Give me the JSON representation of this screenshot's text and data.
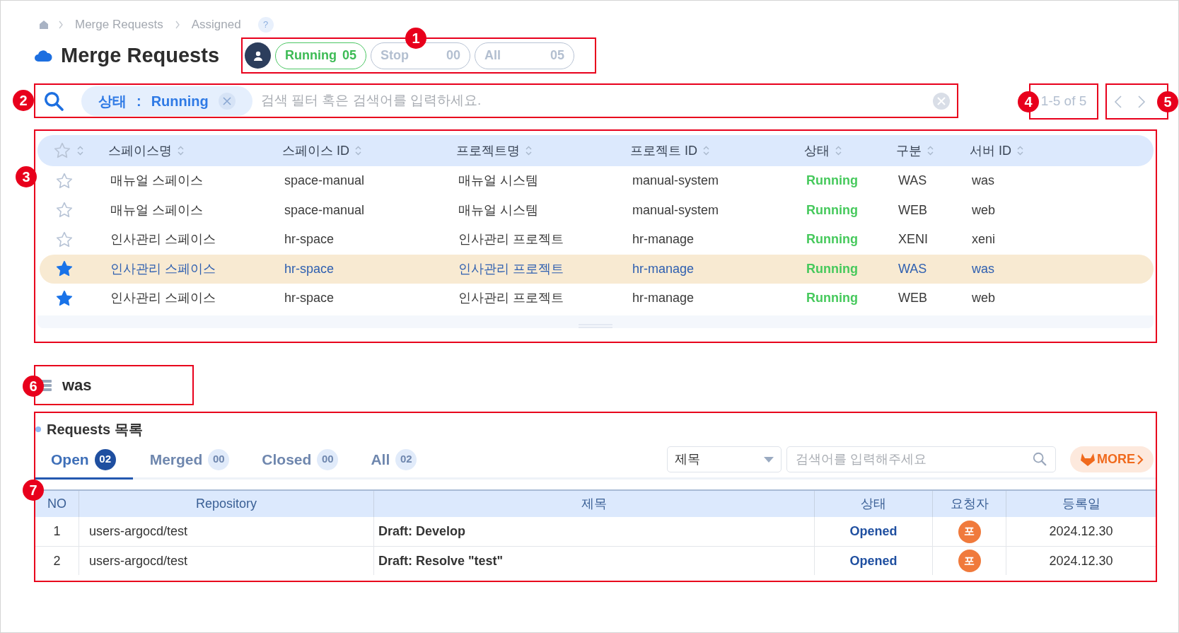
{
  "breadcrumb": [
    "Merge Requests",
    "Assigned"
  ],
  "help": "?",
  "title": "Merge Requests",
  "status_filters": [
    {
      "label": "Running",
      "count": "05",
      "selected": true
    },
    {
      "label": "Stop",
      "count": "00",
      "selected": false
    },
    {
      "label": "All",
      "count": "05",
      "selected": false
    }
  ],
  "search": {
    "chip_key": "상태",
    "chip_separator": ":",
    "chip_value": "Running",
    "placeholder": "검색 필터 혹은 검색어를 입력하세요."
  },
  "pagination": {
    "range": "1-5 of 5"
  },
  "table": {
    "columns": [
      "스페이스명",
      "스페이스 ID",
      "프로젝트명",
      "프로젝트 ID",
      "상태",
      "구분",
      "서버 ID"
    ],
    "rows": [
      {
        "favorite": false,
        "selected": false,
        "space_name": "매뉴얼 스페이스",
        "space_id": "space-manual",
        "project_name": "매뉴얼 시스템",
        "project_id": "manual-system",
        "status": "Running",
        "type": "WAS",
        "server_id": "was"
      },
      {
        "favorite": false,
        "selected": false,
        "space_name": "매뉴얼 스페이스",
        "space_id": "space-manual",
        "project_name": "매뉴얼 시스템",
        "project_id": "manual-system",
        "status": "Running",
        "type": "WEB",
        "server_id": "web"
      },
      {
        "favorite": false,
        "selected": false,
        "space_name": "인사관리 스페이스",
        "space_id": "hr-space",
        "project_name": "인사관리 프로젝트",
        "project_id": "hr-manage",
        "status": "Running",
        "type": "XENI",
        "server_id": "xeni"
      },
      {
        "favorite": true,
        "selected": true,
        "space_name": "인사관리 스페이스",
        "space_id": "hr-space",
        "project_name": "인사관리 프로젝트",
        "project_id": "hr-manage",
        "status": "Running",
        "type": "WAS",
        "server_id": "was"
      },
      {
        "favorite": true,
        "selected": false,
        "space_name": "인사관리 스페이스",
        "space_id": "hr-space",
        "project_name": "인사관리 프로젝트",
        "project_id": "hr-manage",
        "status": "Running",
        "type": "WEB",
        "server_id": "web"
      }
    ]
  },
  "server": {
    "name": "was"
  },
  "requests": {
    "title": "Requests 목록",
    "tabs": [
      {
        "label": "Open",
        "count": "02",
        "selected": true
      },
      {
        "label": "Merged",
        "count": "00",
        "selected": false
      },
      {
        "label": "Closed",
        "count": "00",
        "selected": false
      },
      {
        "label": "All",
        "count": "02",
        "selected": false
      }
    ],
    "filter_select": "제목",
    "search_placeholder": "검색어를 입력해주세요",
    "more_button": "MORE",
    "columns": [
      "NO",
      "Repository",
      "제목",
      "상태",
      "요청자",
      "등록일"
    ],
    "rows": [
      {
        "no": "1",
        "repository": "users-argocd/test",
        "title": "Draft: Develop",
        "status": "Opened",
        "requester": "포",
        "date": "2024.12.30"
      },
      {
        "no": "2",
        "repository": "users-argocd/test",
        "title": "Draft: Resolve \"test\"",
        "status": "Opened",
        "requester": "포",
        "date": "2024.12.30"
      }
    ]
  },
  "callouts": [
    "1",
    "2",
    "3",
    "4",
    "5",
    "6",
    "7"
  ]
}
